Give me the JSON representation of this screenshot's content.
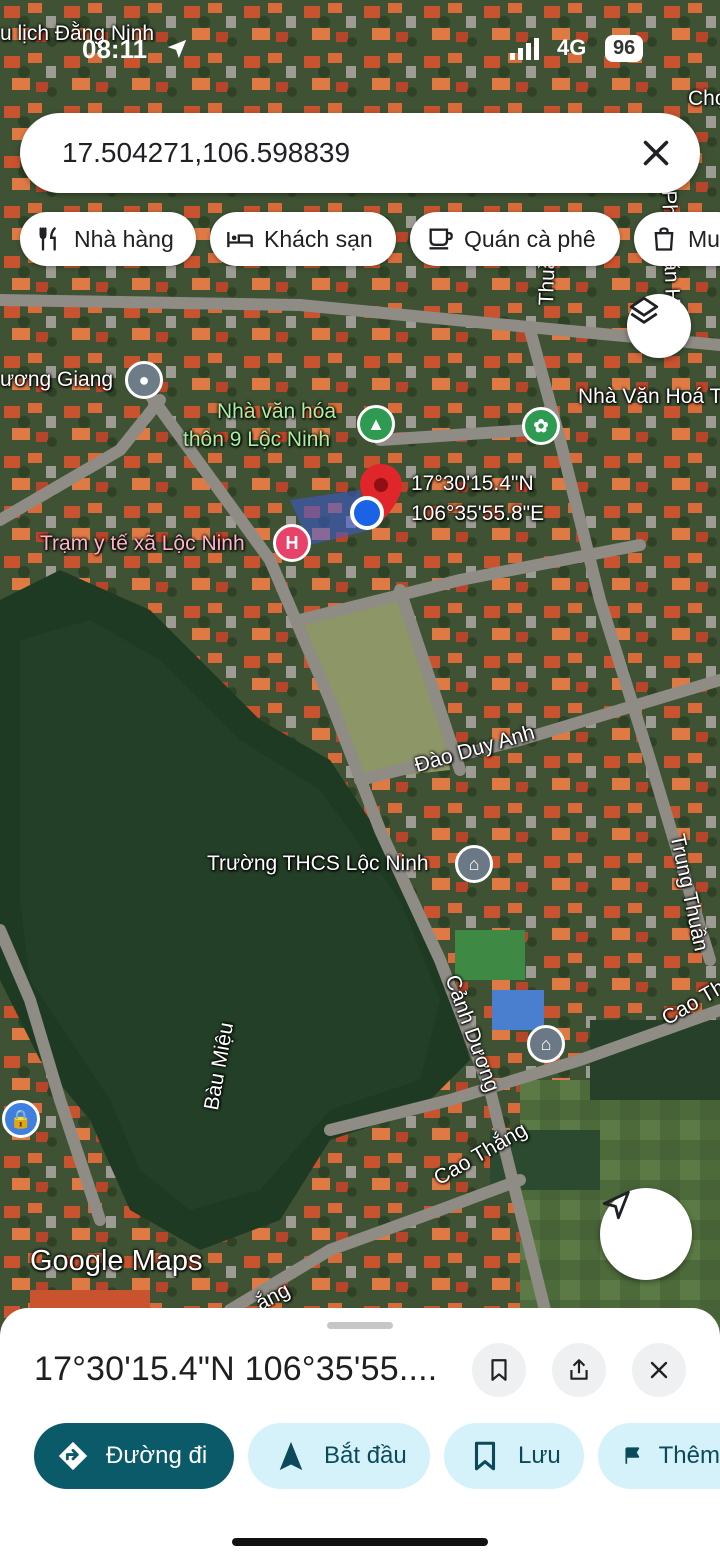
{
  "status_bar": {
    "time": "08:11",
    "network": "4G",
    "battery": "96"
  },
  "search": {
    "query": "17.504271,106.598839"
  },
  "chips": [
    {
      "label": "Nhà hàng",
      "icon": "restaurant-icon"
    },
    {
      "label": "Khách sạn",
      "icon": "hotel-icon"
    },
    {
      "label": "Quán cà phê",
      "icon": "coffee-icon"
    },
    {
      "label": "Mu",
      "icon": "shopping-bag-icon"
    }
  ],
  "map_labels": {
    "tourism_partial": "u lịch Đằng Ninh",
    "cho_partial": "Chợ",
    "giang_partial": "ương Giang",
    "culture_house": "Nhà văn hóa",
    "culture_house_line2": "thôn 9 Lộc Ninh",
    "culture_house_right": "Nhà Văn Hoá T",
    "clinic": "Trạm y tế xã Lộc Ninh",
    "pin_lat": "17°30'15.4\"N",
    "pin_lng": "106°35'55.8\"E",
    "road_dao_duy_anh": "Đào Duy Anh",
    "school": "Trường THCS Lộc Ninh",
    "road_trung_thuan": "Trung Thuần",
    "road_canh_duong": "Cảnh Dương",
    "road_cao_thang": "Cao Thắng",
    "road_cao_thang_right": "Cao Th",
    "road_cao_thang_bottom": "ắng",
    "lake": "Bàu Miệu",
    "road_thuan_partial": "Thuần",
    "road_van_han_partial": "Phan Văn Hai",
    "watermark": "Google Maps"
  },
  "sheet": {
    "title": "17°30'15.4\"N 106°35'55....",
    "actions": [
      {
        "label": "Đường đi",
        "icon": "directions-icon"
      },
      {
        "label": "Bắt đầu",
        "icon": "navigation-arrow-icon"
      },
      {
        "label": "Lưu",
        "icon": "bookmark-icon"
      },
      {
        "label": "Thêm",
        "icon": "flag-icon"
      }
    ]
  },
  "colors": {
    "accent": "#0b5a6a",
    "action_bg": "#d5f2fb",
    "pin": "#e0262b",
    "location": "#1a62e6",
    "hospital": "#e8416a"
  }
}
